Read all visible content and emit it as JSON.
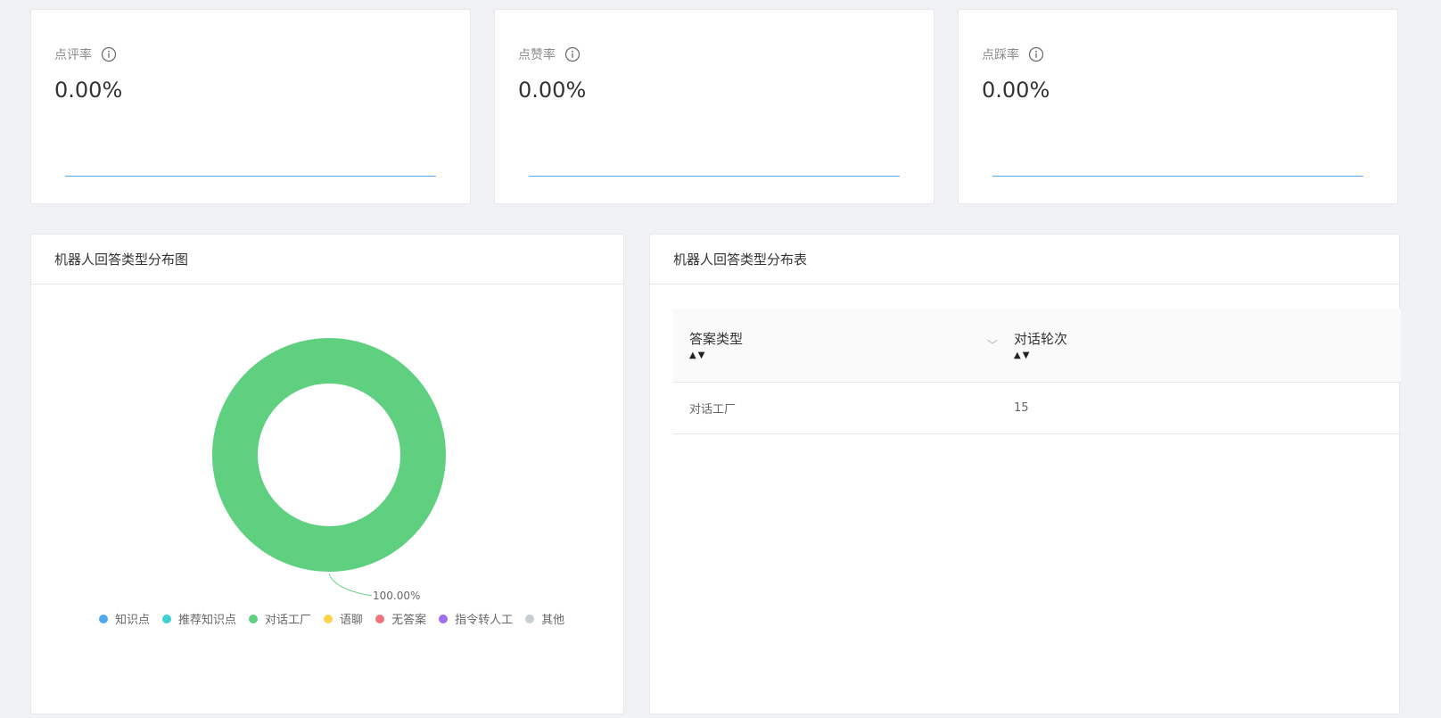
{
  "stats": [
    {
      "label": "点评率",
      "value": "0.00%"
    },
    {
      "label": "点赞率",
      "value": "0.00%"
    },
    {
      "label": "点踩率",
      "value": "0.00%"
    }
  ],
  "chart_panel": {
    "title": "机器人回答类型分布图"
  },
  "table_panel": {
    "title": "机器人回答类型分布表",
    "columns": [
      "答案类型",
      "对话轮次"
    ],
    "rows": [
      [
        "对话工厂",
        "15"
      ]
    ]
  },
  "icons": {
    "info": "info-circle-icon",
    "sort_asc": "caret-up-icon",
    "sort_desc": "caret-down-icon",
    "filter": "chevron-down-icon"
  },
  "colors": {
    "donut_main": "#6ad389",
    "sparkline": "#5aa9f0"
  },
  "chart_data": {
    "type": "pie",
    "donut": true,
    "categories": [
      "知识点",
      "推荐知识点",
      "对话工厂",
      "语聊",
      "无答案",
      "指令转人工",
      "其他"
    ],
    "colors": [
      "#4ea8ef",
      "#3ecfcf",
      "#5fcf80",
      "#fcd34d",
      "#f0727c",
      "#9f6ded",
      "#c4ced6"
    ],
    "values": [
      0,
      0,
      100,
      0,
      0,
      0,
      0
    ],
    "data_labels": [
      "100.00%"
    ],
    "legend_position": "bottom"
  }
}
